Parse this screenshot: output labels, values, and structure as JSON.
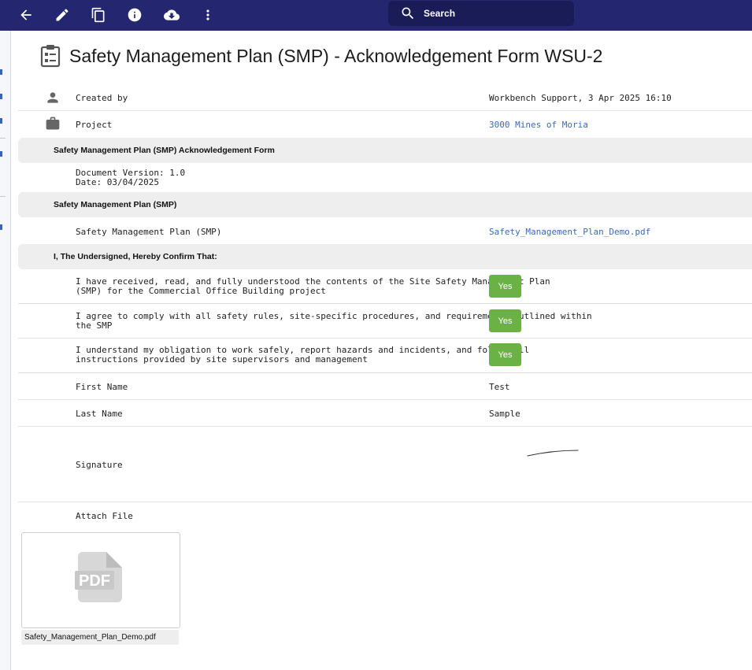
{
  "toolbar": {
    "search_placeholder": "Search",
    "icons": [
      "back-arrow-icon",
      "edit-pencil-icon",
      "copy-icon",
      "info-icon",
      "cloud-download-icon",
      "more-vert-icon",
      "search-icon"
    ]
  },
  "form": {
    "title": "Safety Management Plan (SMP) - Acknowledgement Form WSU-2",
    "created_by": {
      "label": "Created by",
      "value": "Workbench Support, 3 Apr 2025 16:10"
    },
    "project": {
      "label": "Project",
      "value": "3000 Mines of Moria"
    }
  },
  "sections": [
    {
      "header": "Safety Management Plan (SMP) Acknowledgement Form",
      "text_line1": "Document Version: 1.0",
      "text_line2": "Date: 03/04/2025"
    },
    {
      "header": "Safety Management Plan (SMP)",
      "field_label": "Safety Management Plan (SMP)",
      "field_value": "Safety_Management_Plan_Demo.pdf"
    },
    {
      "header": "I, The Undersigned, Hereby Confirm That:",
      "items": [
        {
          "line1": "I have received, read, and fully understood the contents of the Site Safety Management Plan",
          "line2": "(SMP) for the Commercial Office Building project",
          "answer": "Yes"
        },
        {
          "line1": "I agree to comply with all safety rules, site-specific procedures, and requirements outlined within",
          "line2": "the SMP",
          "answer": "Yes"
        },
        {
          "line1": "I understand my obligation to work safely, report hazards and incidents, and follow all",
          "line2": "instructions provided by site supervisors and management",
          "answer": "Yes"
        }
      ]
    }
  ],
  "person": {
    "first_name_label": "First Name",
    "first_name": "Test",
    "last_name_label": "Last Name",
    "last_name": "Sample",
    "signature_label": "Signature",
    "attach_label": "Attach File"
  },
  "attachment": {
    "icon_text": "PDF",
    "filename": "Safety_Management_Plan_Demo.pdf"
  },
  "colors": {
    "topbar": "#24266f",
    "yes_button": "#6cb146",
    "link": "#3b6ab3",
    "section_bg": "#eeeeee"
  }
}
